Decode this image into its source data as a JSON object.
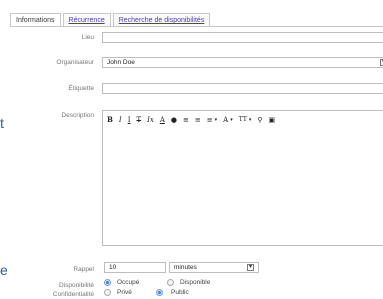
{
  "tabs": [
    {
      "label": "Informations",
      "active": true
    },
    {
      "label": "Récurrence",
      "active": false
    },
    {
      "label": "Recherche de disponibilités",
      "active": false
    }
  ],
  "fields": {
    "lieu": {
      "label": "Lieu",
      "value": ""
    },
    "organisateur": {
      "label": "Organisateur",
      "value": "John Doe"
    },
    "etiquette": {
      "label": "Étiquette",
      "value": ""
    },
    "description": {
      "label": "Description"
    },
    "rappel": {
      "label": "Rappel",
      "value": "10",
      "unit": "minutes"
    },
    "disponibilite": {
      "label": "Disponibilité",
      "options": [
        "Occupé",
        "Disponible"
      ],
      "selected": "Occupé"
    },
    "confidentialite": {
      "label": "Confidentialité",
      "options": [
        "Privé",
        "Public"
      ],
      "selected": "Public"
    }
  },
  "toolbar": {
    "bold": "B",
    "italic": "I",
    "underline": "I",
    "strike": "T",
    "clear_format": "Ix",
    "font_color": "A",
    "highlight": "●",
    "numbered_list": "≡",
    "bullet_list": "≡",
    "align": "≡",
    "align_caret": "▾",
    "font_family": "A",
    "font_family_caret": "▾",
    "font_size": "TT",
    "font_size_caret": "▾",
    "link": "⚲",
    "image": "▣"
  },
  "edge_glyphs": {
    "upper": "t",
    "lower": "e"
  }
}
